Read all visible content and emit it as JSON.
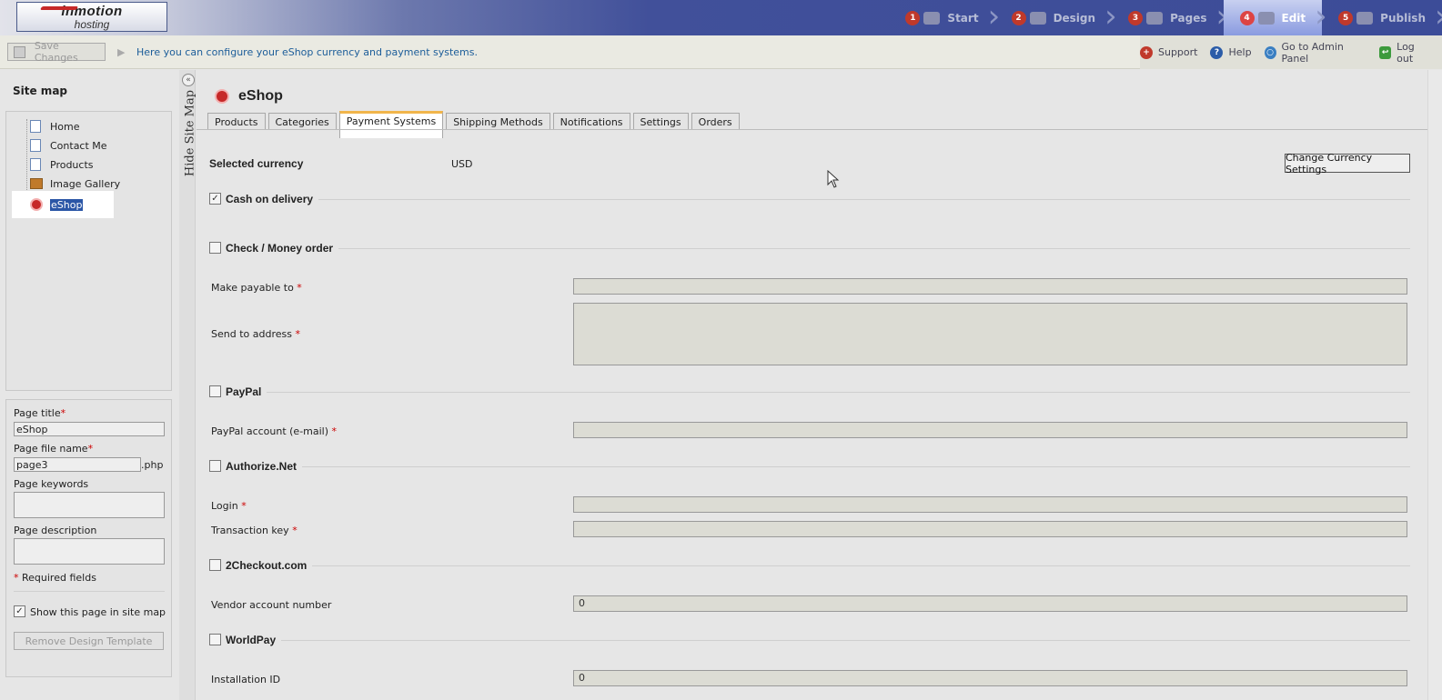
{
  "header": {
    "logo_line1": "inmotion",
    "logo_line2": "hosting",
    "steps": [
      {
        "num": "1",
        "label": "Start"
      },
      {
        "num": "2",
        "label": "Design"
      },
      {
        "num": "3",
        "label": "Pages"
      },
      {
        "num": "4",
        "label": "Edit",
        "active": true
      },
      {
        "num": "5",
        "label": "Publish"
      }
    ]
  },
  "toolbar": {
    "save_label": "Save Changes",
    "hint": "Here you can configure your eShop currency and payment systems.",
    "links": [
      {
        "label": "Support",
        "icon": "lifebuoy-icon",
        "color": "#c0392b",
        "glyph": "+"
      },
      {
        "label": "Help",
        "icon": "help-icon",
        "color": "#2b5ca8",
        "glyph": "?"
      },
      {
        "label": "Go to Admin Panel",
        "icon": "admin-globe-icon",
        "color": "#3a7fc2",
        "glyph": "○"
      },
      {
        "label": "Log out",
        "icon": "logout-icon",
        "color": "#3c9a3c",
        "glyph": "↩"
      }
    ]
  },
  "sidebar": {
    "title": "Site map",
    "tree": [
      {
        "label": "Home",
        "icon": "page-icon"
      },
      {
        "label": "Contact Me",
        "icon": "page-icon"
      },
      {
        "label": "Products",
        "icon": "page-icon"
      },
      {
        "label": "Image Gallery",
        "icon": "gallery-icon"
      },
      {
        "label": "eShop",
        "icon": "eshop-icon",
        "selected": true
      }
    ],
    "props": {
      "page_title_label": "Page title",
      "page_title_value": "eShop",
      "file_name_label": "Page file name",
      "file_name_value": "page3",
      "file_ext": ".php",
      "keywords_label": "Page keywords",
      "description_label": "Page description",
      "required_note": "Required fields",
      "show_in_map_label": "Show this page in site map",
      "show_in_map_checked": true,
      "remove_template_label": "Remove Design Template"
    },
    "hide_label": "Hide Site Map"
  },
  "main": {
    "title": "eShop",
    "tabs": [
      {
        "label": "Products"
      },
      {
        "label": "Categories"
      },
      {
        "label": "Payment Systems",
        "active": true
      },
      {
        "label": "Shipping Methods"
      },
      {
        "label": "Notifications"
      },
      {
        "label": "Settings"
      },
      {
        "label": "Orders"
      }
    ],
    "currency_label": "Selected currency",
    "currency_value": "USD",
    "currency_button": "Change Currency Settings",
    "sections": {
      "cod": {
        "name": "Cash on delivery",
        "checked": true
      },
      "check": {
        "name": "Check / Money order",
        "checked": false,
        "payable_label": "Make payable to",
        "address_label": "Send to address"
      },
      "paypal": {
        "name": "PayPal",
        "checked": false,
        "account_label": "PayPal account (e-mail)"
      },
      "authnet": {
        "name": "Authorize.Net",
        "checked": false,
        "login_label": "Login",
        "key_label": "Transaction key"
      },
      "twocheckout": {
        "name": "2Checkout.com",
        "checked": false,
        "vendor_label": "Vendor account number",
        "vendor_value": "0"
      },
      "worldpay": {
        "name": "WorldPay",
        "checked": false,
        "install_label": "Installation ID",
        "install_value": "0"
      }
    },
    "required_mark": "*"
  }
}
